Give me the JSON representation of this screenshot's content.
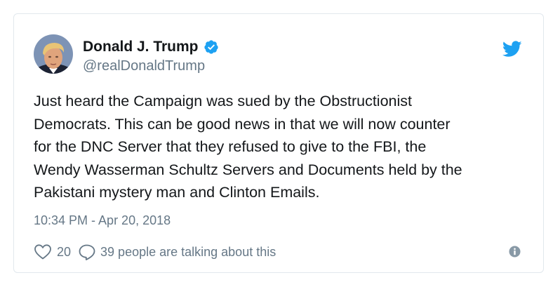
{
  "tweet": {
    "display_name": "Donald J. Trump",
    "handle": "@realDonaldTrump",
    "verified": true,
    "text": "Just heard the Campaign was sued by the Obstructionist\nDemocrats. This can be good news in that we will now counter\nfor the DNC Server that they refused to give to the FBI, the\nWendy Wasserman Schultz Servers and Documents held by the\nPakistani mystery man and Clinton Emails.",
    "timestamp": "10:34 PM - Apr 20, 2018",
    "like_count": "20",
    "talking_text": "39 people are talking about this"
  },
  "icons": {
    "brand": "twitter-bird-icon",
    "verified": "verified-badge-icon",
    "like": "heart-icon",
    "reply": "reply-bubble-icon",
    "info": "info-icon"
  },
  "colors": {
    "brand_blue": "#1da1f2",
    "text": "#14171a",
    "secondary": "#657786",
    "border": "#e1e8ed"
  }
}
